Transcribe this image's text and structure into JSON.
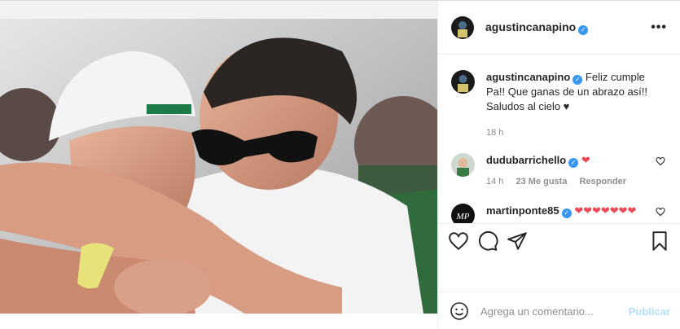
{
  "post": {
    "username": "agustincanapino",
    "verified_mark": "✓",
    "more_icon": "more-icon"
  },
  "caption": {
    "username": "agustincanapino",
    "text": "Feliz cumple Pa!! Que ganas de un abrazo así!! Saludos al cielo ♥",
    "time": "18 h"
  },
  "comments": [
    {
      "username": "dudubarrichello",
      "text": "❤",
      "time": "14 h",
      "likes": "23 Me gusta",
      "reply": "Responder"
    },
    {
      "username": "martinponte85",
      "text": "❤❤❤❤❤❤❤",
      "avatar_initials": "MP"
    }
  ],
  "add_comment": {
    "placeholder": "Agrega un comentario...",
    "publish_label": "Publicar"
  },
  "colors": {
    "accent": "#3897f0",
    "heart": "#ed4956",
    "publish_disabled": "#b2dffc"
  }
}
